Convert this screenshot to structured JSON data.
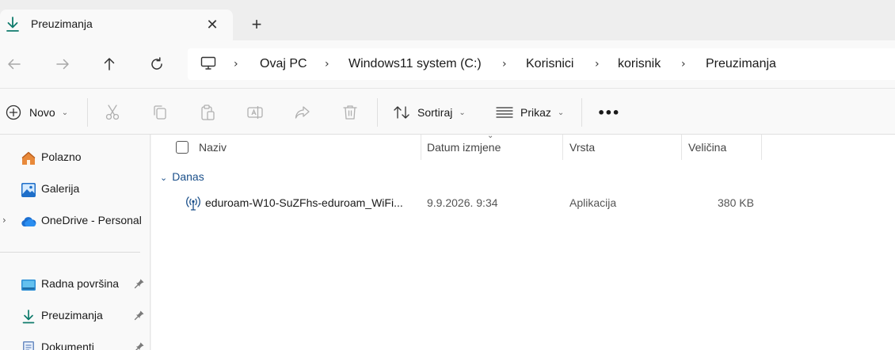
{
  "tab": {
    "title": "Preuzimanja",
    "close": "✕",
    "new_tab": "+"
  },
  "address": {
    "crumbs": [
      "Ovaj PC",
      "Windows11 system (C:)",
      "Korisnici",
      "korisnik",
      "Preuzimanja"
    ],
    "separator": "›"
  },
  "toolbar": {
    "new_label": "Novo",
    "sort_label": "Sortiraj",
    "view_label": "Prikaz",
    "more_label": "•••"
  },
  "sidebar": {
    "items": [
      {
        "label": "Polazno",
        "icon": "home-icon"
      },
      {
        "label": "Galerija",
        "icon": "gallery-icon"
      },
      {
        "label": "OneDrive - Personal",
        "icon": "onedrive-icon"
      },
      {
        "label": "Radna površina",
        "icon": "desktop-icon",
        "pinned": true
      },
      {
        "label": "Preuzimanja",
        "icon": "downloads-icon",
        "pinned": true
      },
      {
        "label": "Dokumenti",
        "icon": "documents-icon",
        "pinned": true
      }
    ],
    "expander": "›"
  },
  "columns": {
    "name": "Naziv",
    "date": "Datum izmjene",
    "type": "Vrsta",
    "size": "Veličina"
  },
  "group": {
    "label": "Danas",
    "caret": "⌄"
  },
  "files": [
    {
      "name": "eduroam-W10-SuZFhs-eduroam_WiFi...",
      "date": "9.9.2026. 9:34",
      "type": "Aplikacija",
      "size": "380 KB",
      "icon": "wifi-app-icon"
    }
  ],
  "colors": {
    "accent": "#0f7b6c",
    "link": "#1a4f8a",
    "onedrive": "#1c6fd1",
    "home": "#e07a2e"
  }
}
